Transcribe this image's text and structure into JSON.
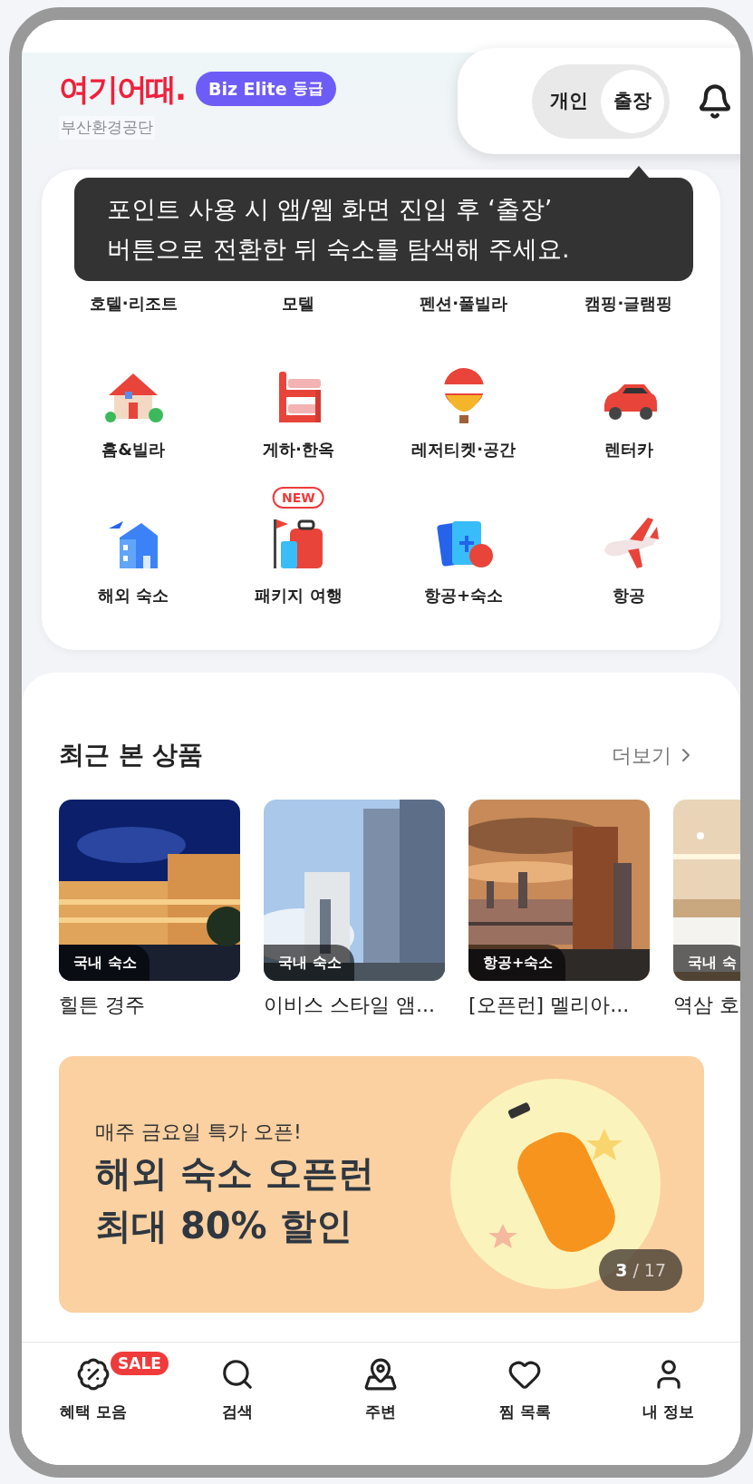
{
  "header": {
    "logo": "여기어때.",
    "grade_badge": {
      "brand": "Biz Elite",
      "label": "등급"
    },
    "company": "부산환경공단"
  },
  "mode_toggle": [
    {
      "label": "개인",
      "selected": false
    },
    {
      "label": "출장",
      "selected": true
    }
  ],
  "tooltip": {
    "lines": [
      "포인트 사용 시 앱/웹 화면 진입 후 ‘출장’",
      "버튼으로 전환한 뒤 숙소를 탐색해 주세요."
    ]
  },
  "categories": [
    {
      "label": "호텔·리조트"
    },
    {
      "label": "모텔"
    },
    {
      "label": "펜션·풀빌라"
    },
    {
      "label": "캠핑·글램핑"
    },
    {
      "label": "홈&빌라"
    },
    {
      "label": "게하·한옥"
    },
    {
      "label": "레저티켓·공간"
    },
    {
      "label": "렌터카"
    },
    {
      "label": "해외 숙소"
    },
    {
      "label": "패키지 여행",
      "badge": "NEW"
    },
    {
      "label": "항공+숙소"
    },
    {
      "label": "항공"
    }
  ],
  "recent": {
    "title": "최근 본 상품",
    "more": "더보기",
    "items": [
      {
        "tag": "국내 숙소",
        "name": "힐튼 경주"
      },
      {
        "tag": "국내 숙소",
        "name": "이비스 스타일 앰..."
      },
      {
        "tag": "항공+숙소",
        "name": "[오픈런] 멜리아..."
      },
      {
        "tag": "국내 숙",
        "name": "역삼 호"
      }
    ]
  },
  "banner": {
    "subtitle": "매주 금요일 특가 오픈!",
    "title_lines": [
      "해외 숙소 오픈런",
      "최대 80% 할인"
    ],
    "page_current": "3",
    "page_total": "/ 17"
  },
  "bottom_nav": [
    {
      "label": "혜택 모음",
      "badge": "SALE"
    },
    {
      "label": "검색"
    },
    {
      "label": "주변"
    },
    {
      "label": "찜 목록"
    },
    {
      "label": "내 정보"
    }
  ]
}
